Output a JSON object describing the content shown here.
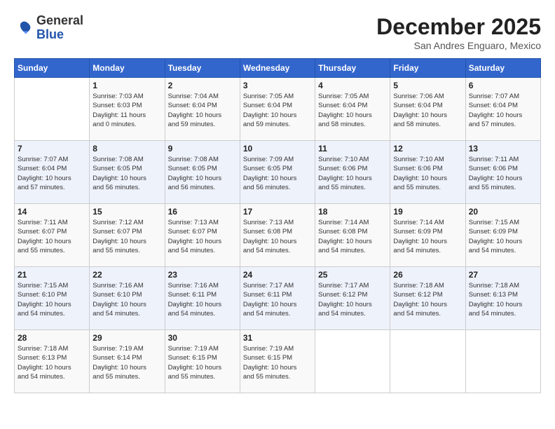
{
  "header": {
    "logo_general": "General",
    "logo_blue": "Blue",
    "month_title": "December 2025",
    "location": "San Andres Enguaro, Mexico"
  },
  "days_of_week": [
    "Sunday",
    "Monday",
    "Tuesday",
    "Wednesday",
    "Thursday",
    "Friday",
    "Saturday"
  ],
  "weeks": [
    [
      {
        "day": "",
        "info": ""
      },
      {
        "day": "1",
        "info": "Sunrise: 7:03 AM\nSunset: 6:03 PM\nDaylight: 11 hours\nand 0 minutes."
      },
      {
        "day": "2",
        "info": "Sunrise: 7:04 AM\nSunset: 6:04 PM\nDaylight: 10 hours\nand 59 minutes."
      },
      {
        "day": "3",
        "info": "Sunrise: 7:05 AM\nSunset: 6:04 PM\nDaylight: 10 hours\nand 59 minutes."
      },
      {
        "day": "4",
        "info": "Sunrise: 7:05 AM\nSunset: 6:04 PM\nDaylight: 10 hours\nand 58 minutes."
      },
      {
        "day": "5",
        "info": "Sunrise: 7:06 AM\nSunset: 6:04 PM\nDaylight: 10 hours\nand 58 minutes."
      },
      {
        "day": "6",
        "info": "Sunrise: 7:07 AM\nSunset: 6:04 PM\nDaylight: 10 hours\nand 57 minutes."
      }
    ],
    [
      {
        "day": "7",
        "info": "Sunrise: 7:07 AM\nSunset: 6:04 PM\nDaylight: 10 hours\nand 57 minutes."
      },
      {
        "day": "8",
        "info": "Sunrise: 7:08 AM\nSunset: 6:05 PM\nDaylight: 10 hours\nand 56 minutes."
      },
      {
        "day": "9",
        "info": "Sunrise: 7:08 AM\nSunset: 6:05 PM\nDaylight: 10 hours\nand 56 minutes."
      },
      {
        "day": "10",
        "info": "Sunrise: 7:09 AM\nSunset: 6:05 PM\nDaylight: 10 hours\nand 56 minutes."
      },
      {
        "day": "11",
        "info": "Sunrise: 7:10 AM\nSunset: 6:06 PM\nDaylight: 10 hours\nand 55 minutes."
      },
      {
        "day": "12",
        "info": "Sunrise: 7:10 AM\nSunset: 6:06 PM\nDaylight: 10 hours\nand 55 minutes."
      },
      {
        "day": "13",
        "info": "Sunrise: 7:11 AM\nSunset: 6:06 PM\nDaylight: 10 hours\nand 55 minutes."
      }
    ],
    [
      {
        "day": "14",
        "info": "Sunrise: 7:11 AM\nSunset: 6:07 PM\nDaylight: 10 hours\nand 55 minutes."
      },
      {
        "day": "15",
        "info": "Sunrise: 7:12 AM\nSunset: 6:07 PM\nDaylight: 10 hours\nand 55 minutes."
      },
      {
        "day": "16",
        "info": "Sunrise: 7:13 AM\nSunset: 6:07 PM\nDaylight: 10 hours\nand 54 minutes."
      },
      {
        "day": "17",
        "info": "Sunrise: 7:13 AM\nSunset: 6:08 PM\nDaylight: 10 hours\nand 54 minutes."
      },
      {
        "day": "18",
        "info": "Sunrise: 7:14 AM\nSunset: 6:08 PM\nDaylight: 10 hours\nand 54 minutes."
      },
      {
        "day": "19",
        "info": "Sunrise: 7:14 AM\nSunset: 6:09 PM\nDaylight: 10 hours\nand 54 minutes."
      },
      {
        "day": "20",
        "info": "Sunrise: 7:15 AM\nSunset: 6:09 PM\nDaylight: 10 hours\nand 54 minutes."
      }
    ],
    [
      {
        "day": "21",
        "info": "Sunrise: 7:15 AM\nSunset: 6:10 PM\nDaylight: 10 hours\nand 54 minutes."
      },
      {
        "day": "22",
        "info": "Sunrise: 7:16 AM\nSunset: 6:10 PM\nDaylight: 10 hours\nand 54 minutes."
      },
      {
        "day": "23",
        "info": "Sunrise: 7:16 AM\nSunset: 6:11 PM\nDaylight: 10 hours\nand 54 minutes."
      },
      {
        "day": "24",
        "info": "Sunrise: 7:17 AM\nSunset: 6:11 PM\nDaylight: 10 hours\nand 54 minutes."
      },
      {
        "day": "25",
        "info": "Sunrise: 7:17 AM\nSunset: 6:12 PM\nDaylight: 10 hours\nand 54 minutes."
      },
      {
        "day": "26",
        "info": "Sunrise: 7:18 AM\nSunset: 6:12 PM\nDaylight: 10 hours\nand 54 minutes."
      },
      {
        "day": "27",
        "info": "Sunrise: 7:18 AM\nSunset: 6:13 PM\nDaylight: 10 hours\nand 54 minutes."
      }
    ],
    [
      {
        "day": "28",
        "info": "Sunrise: 7:18 AM\nSunset: 6:13 PM\nDaylight: 10 hours\nand 54 minutes."
      },
      {
        "day": "29",
        "info": "Sunrise: 7:19 AM\nSunset: 6:14 PM\nDaylight: 10 hours\nand 55 minutes."
      },
      {
        "day": "30",
        "info": "Sunrise: 7:19 AM\nSunset: 6:15 PM\nDaylight: 10 hours\nand 55 minutes."
      },
      {
        "day": "31",
        "info": "Sunrise: 7:19 AM\nSunset: 6:15 PM\nDaylight: 10 hours\nand 55 minutes."
      },
      {
        "day": "",
        "info": ""
      },
      {
        "day": "",
        "info": ""
      },
      {
        "day": "",
        "info": ""
      }
    ]
  ]
}
